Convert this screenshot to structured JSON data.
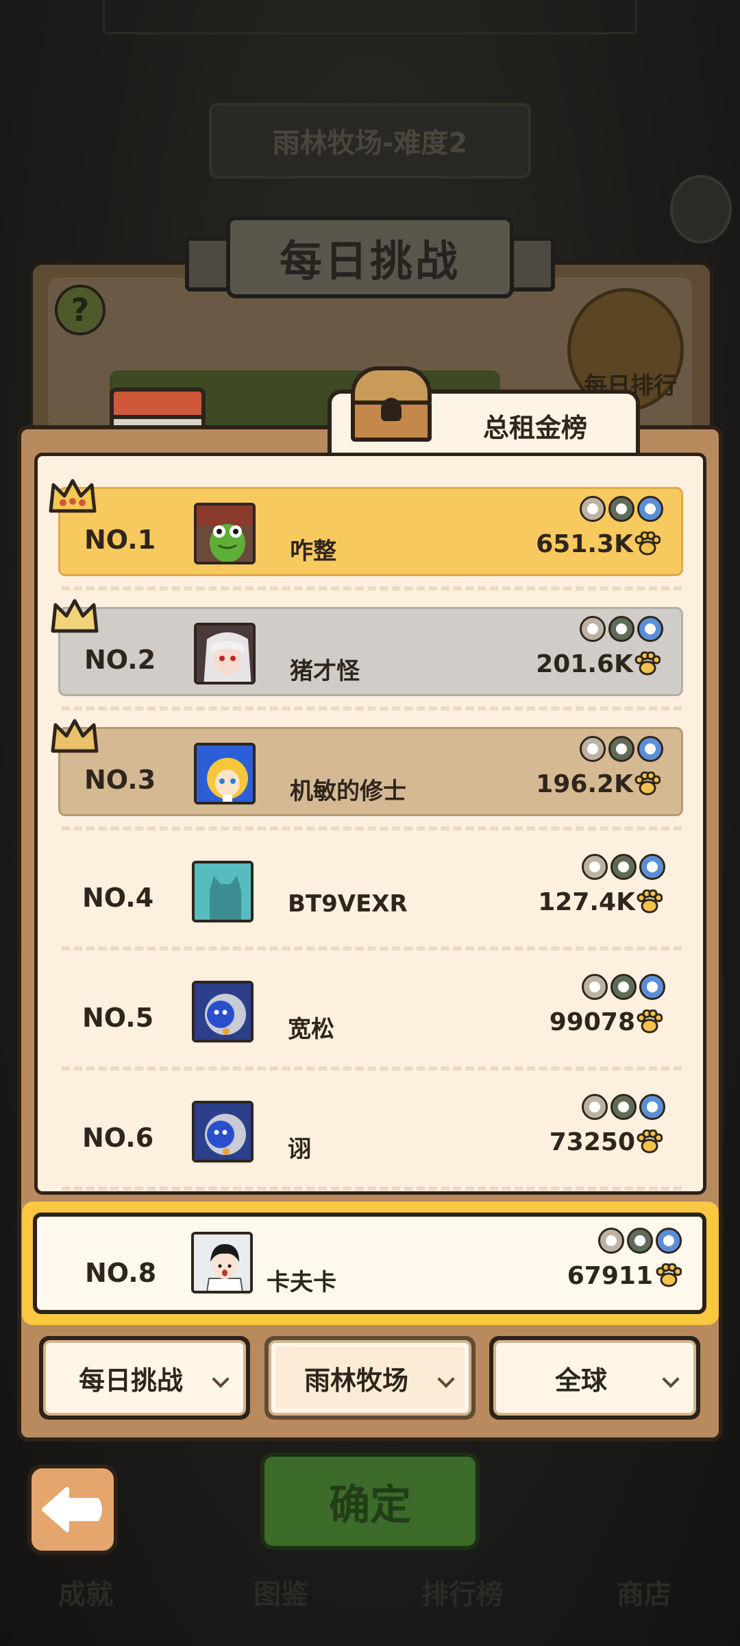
{
  "background": {
    "stage_title": "雨林牧场-难度2",
    "header_title": "每日挑战",
    "help_symbol": "?",
    "daily_rank_label": "每日排行",
    "bottom_nav": [
      "成就",
      "图鉴",
      "排行榜",
      "商店"
    ]
  },
  "tab": {
    "label": "总租金榜",
    "icon": "treasure-chest-icon"
  },
  "leaderboard": [
    {
      "rank": "NO.1",
      "name": "咋整",
      "score": "651.3K",
      "style": "gold",
      "crown": "gold-crown-icon",
      "avatar": "frog-plush-avatar"
    },
    {
      "rank": "NO.2",
      "name": "猪才怪",
      "score": "201.6K",
      "style": "silver",
      "crown": "silver-crown-icon",
      "avatar": "anime-girl-avatar"
    },
    {
      "rank": "NO.3",
      "name": "机敏的修士",
      "score": "196.2K",
      "style": "bronze",
      "crown": "bronze-crown-icon",
      "avatar": "yellow-hair-avatar"
    },
    {
      "rank": "NO.4",
      "name": "BT9VEXR",
      "score": "127.4K",
      "style": "plain",
      "avatar": "default-cat-silhouette-avatar"
    },
    {
      "rank": "NO.5",
      "name": "宽松",
      "score": "99078",
      "style": "plain",
      "avatar": "robot-avatar"
    },
    {
      "rank": "NO.6",
      "name": "诩",
      "score": "73250",
      "style": "plain",
      "avatar": "robot-avatar"
    }
  ],
  "my_entry": {
    "rank": "NO.8",
    "name": "卡夫卡",
    "score": "67911",
    "avatar": "cartoon-boy-avatar"
  },
  "filters": [
    {
      "label": "每日挑战"
    },
    {
      "label": "雨林牧场"
    },
    {
      "label": "全球"
    }
  ],
  "confirm_label": "确定",
  "colors": {
    "gold_row": "#f8c95e",
    "silver_row": "#d0ccc7",
    "bronze_row": "#d4b993",
    "panel": "#b88a5e",
    "list_bg": "#fdf0de",
    "highlight_frame": "#fac741"
  }
}
